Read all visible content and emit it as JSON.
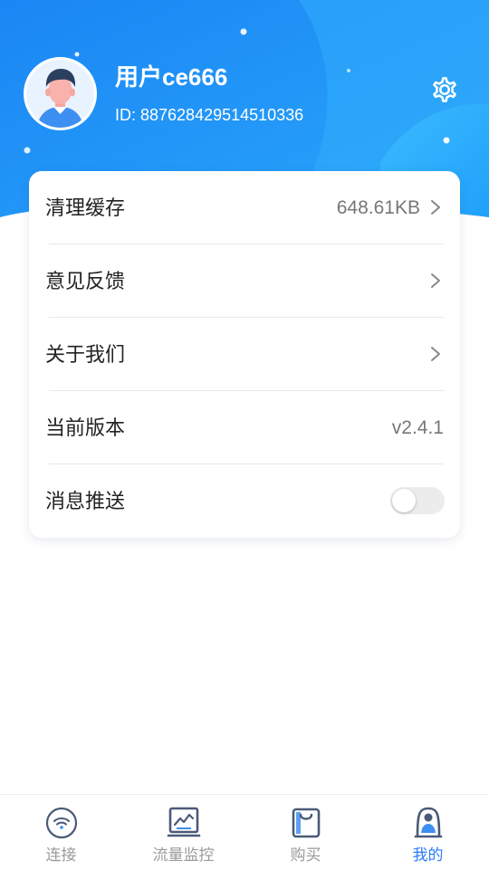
{
  "profile": {
    "username": "用户ce666",
    "user_id": "ID: 887628429514510336",
    "avatar_icon": "user-avatar",
    "settings_icon": "gear-icon"
  },
  "settings_list": [
    {
      "label": "清理缓存",
      "value": "648.61KB",
      "chevron": true
    },
    {
      "label": "意见反馈",
      "value": "",
      "chevron": true
    },
    {
      "label": "关于我们",
      "value": "",
      "chevron": true
    },
    {
      "label": "当前版本",
      "value": "v2.4.1",
      "chevron": false
    },
    {
      "label": "消息推送",
      "toggle": false
    }
  ],
  "tabbar": {
    "active_index": 3,
    "items": [
      {
        "label": "连接",
        "icon": "wifi-icon"
      },
      {
        "label": "流量监控",
        "icon": "chart-monitor-icon"
      },
      {
        "label": "购买",
        "icon": "shopping-bag-icon"
      },
      {
        "label": "我的",
        "icon": "profile-icon"
      }
    ]
  },
  "colors": {
    "header_gradient_start": "#1e8ef6",
    "header_gradient_end": "#3cb6ff",
    "accent": "#2b7cf6",
    "text_primary": "#222222",
    "text_secondary": "#777777"
  }
}
